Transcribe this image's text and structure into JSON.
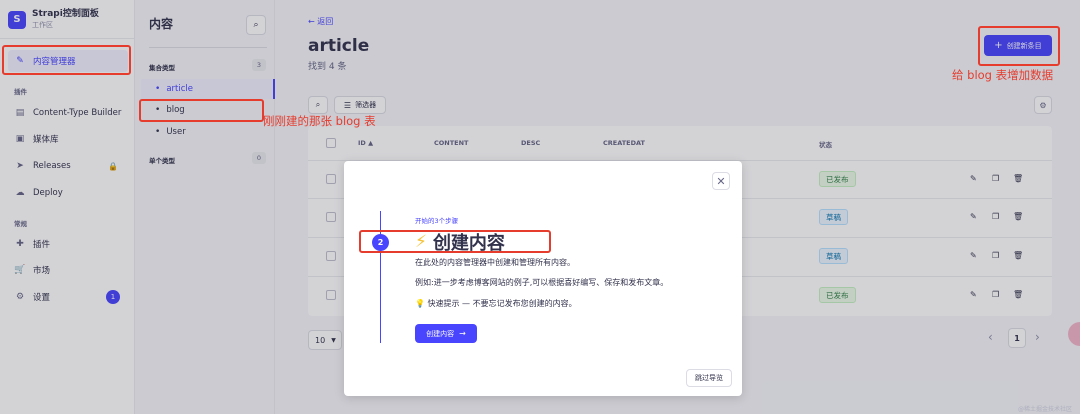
{
  "brand": {
    "title": "Strapi控制面板",
    "subtitle": "工作区",
    "logo_letter": "S"
  },
  "nav": {
    "content_manager": "内容管理器",
    "plugins_section": "插件",
    "content_type_builder": "Content-Type Builder",
    "media_library": "媒体库",
    "releases": "Releases",
    "deploy": "Deploy",
    "general_section": "常规",
    "plugins": "插件",
    "market": "市场",
    "settings": "设置",
    "settings_badge": "1"
  },
  "subnav": {
    "title": "内容",
    "collection_section": "集合类型",
    "collection_count": "3",
    "items": [
      "article",
      "blog",
      "User"
    ],
    "single_section": "单个类型",
    "single_count": "0"
  },
  "header": {
    "back": "返回",
    "title": "article",
    "subtitle": "找到 4 条",
    "create_button": "创建新条目"
  },
  "toolbar": {
    "filter": "筛选器"
  },
  "table": {
    "headers": {
      "id": "ID",
      "content": "CONTENT",
      "desc": "DESC",
      "createdat": "CREATEDAT",
      "status": "状态"
    },
    "rows": [
      {
        "status": "已发布"
      },
      {
        "status": "草稿"
      },
      {
        "status": "草稿"
      },
      {
        "status": "已发布"
      }
    ]
  },
  "pagination": {
    "per_page": "10",
    "current_page": "1"
  },
  "modal": {
    "step_label": "开始的3个步骤",
    "step_number": "2",
    "title": "创建内容",
    "line1": "在此处的内容管理器中创建和管理所有内容。",
    "line2": "例如:进一步考虑博客网站的例子,可以根据喜好编写、保存和发布文章。",
    "line3": "快速提示 — 不要忘记发布您创建的内容。",
    "button": "创建内容",
    "skip": "跳过导览"
  },
  "annotations": {
    "create_data": "给 blog 表增加数据",
    "blog_note": "刚刚建的那张 blog 表"
  },
  "watermark": "@稀土掘金技术社区",
  "colors": {
    "primary": "#4945ff",
    "annotation": "#e53c2e",
    "published": "#328048",
    "draft": "#0c75af"
  }
}
